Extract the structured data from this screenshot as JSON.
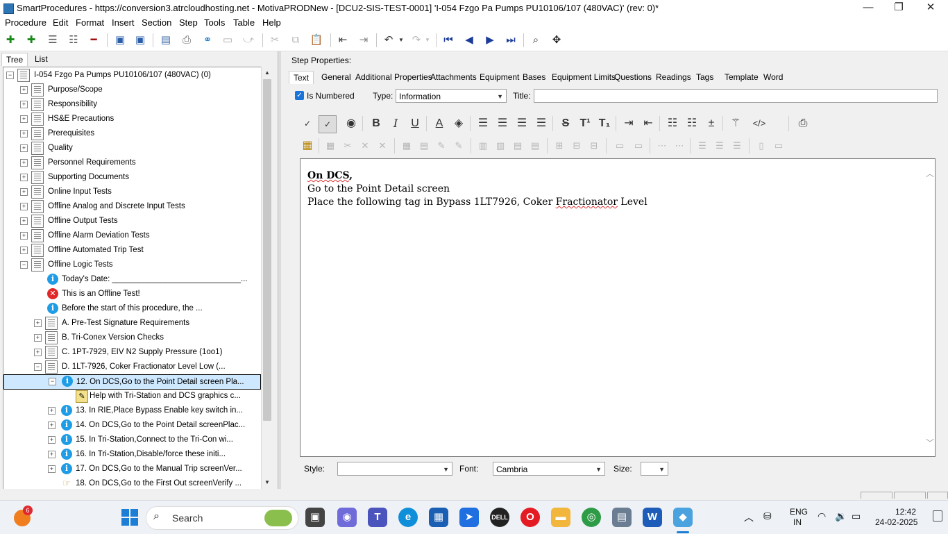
{
  "window": {
    "title": "SmartProcedures - https://conversion3.atrcloudhosting.net - MotivaPRODNew - [DCU2-SIS-TEST-0001] 'I-054 Fzgo Pa Pumps PU10106/107 (480VAC)' (rev: 0)*",
    "minimize": "—",
    "restore": "❐",
    "close": "✕"
  },
  "menu": [
    "Procedure",
    "Edit",
    "Format",
    "Insert",
    "Section",
    "Step",
    "Tools",
    "Table",
    "Help"
  ],
  "left_panel": {
    "tabs": [
      "Tree",
      "List"
    ],
    "tree": {
      "root": "I-054 Fzgo Pa Pumps PU10106/107 (480VAC) (0)",
      "sections": [
        "Purpose/Scope",
        "Responsibility",
        "HS&E Precautions",
        "Prerequisites",
        "Quality",
        "Personnel Requirements",
        "Supporting Documents",
        "Online Input Tests",
        "Offline Analog and Discrete Input Tests",
        "Offline Output Tests",
        "Offline Alarm Deviation Tests",
        "Offline Automated Trip Test",
        "Offline Logic Tests"
      ],
      "logic_children": [
        "Today's Date: _____________________________...",
        "This is an Offline Test!",
        "Before the start of this procedure, the ..."
      ],
      "subsections": [
        "A. Pre-Test Signature Requirements",
        "B. Tri-Conex Version Checks",
        "C. 1PT-7929, EIV N2 Supply Pressure (1oo1)",
        "D. 1LT-7926, Coker Fractionator Level Low (..."
      ],
      "steps": [
        "12. On DCS,Go to the Point Detail screen Pla...",
        "Help with Tri-Station and DCS graphics c...",
        "13. In RIE,Place Bypass Enable key switch in...",
        "14. On DCS,Go to the Point Detail screenPlac...",
        "15. In Tri-Station,Connect to the Tri-Con wi...",
        "16. In Tri-Station,Disable/force these initi...",
        "17. On DCS,Go to the Manual Trip screenVer...",
        "18. On DCS,Go to the First Out screenVerify ..."
      ]
    }
  },
  "step_properties": {
    "heading": "Step Properties:",
    "tabs": [
      "Text",
      "General",
      "Additional Properties",
      "Attachments",
      "Equipment",
      "Bases",
      "Equipment Limits",
      "Questions",
      "Readings",
      "Tags",
      "Template",
      "Word"
    ],
    "is_numbered_label": "Is Numbered",
    "type_label": "Type:",
    "type_value": "Information",
    "title_label": "Title:",
    "title_value": "",
    "editor": {
      "line1_bold": "On DCS",
      "line1_rest": ",",
      "line2": "Go to the Point Detail screen",
      "line3_a": "Place the following tag in Bypass 1LT7926, Coker ",
      "line3_b": "Fractionator",
      "line3_c": " Level"
    },
    "style_label": "Style:",
    "style_value": "",
    "font_label": "Font:",
    "font_value": "Cambria",
    "size_label": "Size:",
    "size_value": ""
  },
  "taskbar": {
    "search_label": "Search",
    "notification_count": "6",
    "lang_line1": "ENG",
    "lang_line2": "IN",
    "time": "12:42",
    "date": "24-02-2025"
  }
}
